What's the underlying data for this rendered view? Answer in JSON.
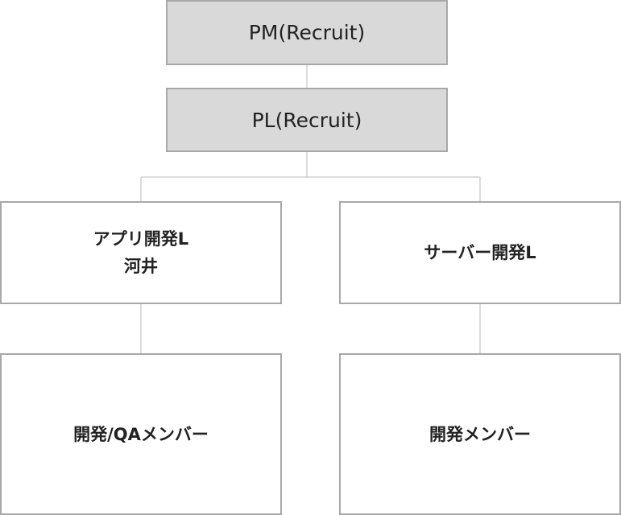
{
  "nodes": {
    "pm": {
      "label": "PM(Recruit)"
    },
    "pl": {
      "label": "PL(Recruit)"
    },
    "app_lead": {
      "title": "アプリ開発L",
      "name": "河井"
    },
    "server_lead": {
      "title": "サーバー開発L"
    },
    "dev_qa": {
      "label": "開発/QAメンバー"
    },
    "dev": {
      "label": "開発メンバー"
    }
  },
  "colors": {
    "gray_fill": "#d9d9d9",
    "border": "#a8a8a8",
    "text": "#222222"
  }
}
